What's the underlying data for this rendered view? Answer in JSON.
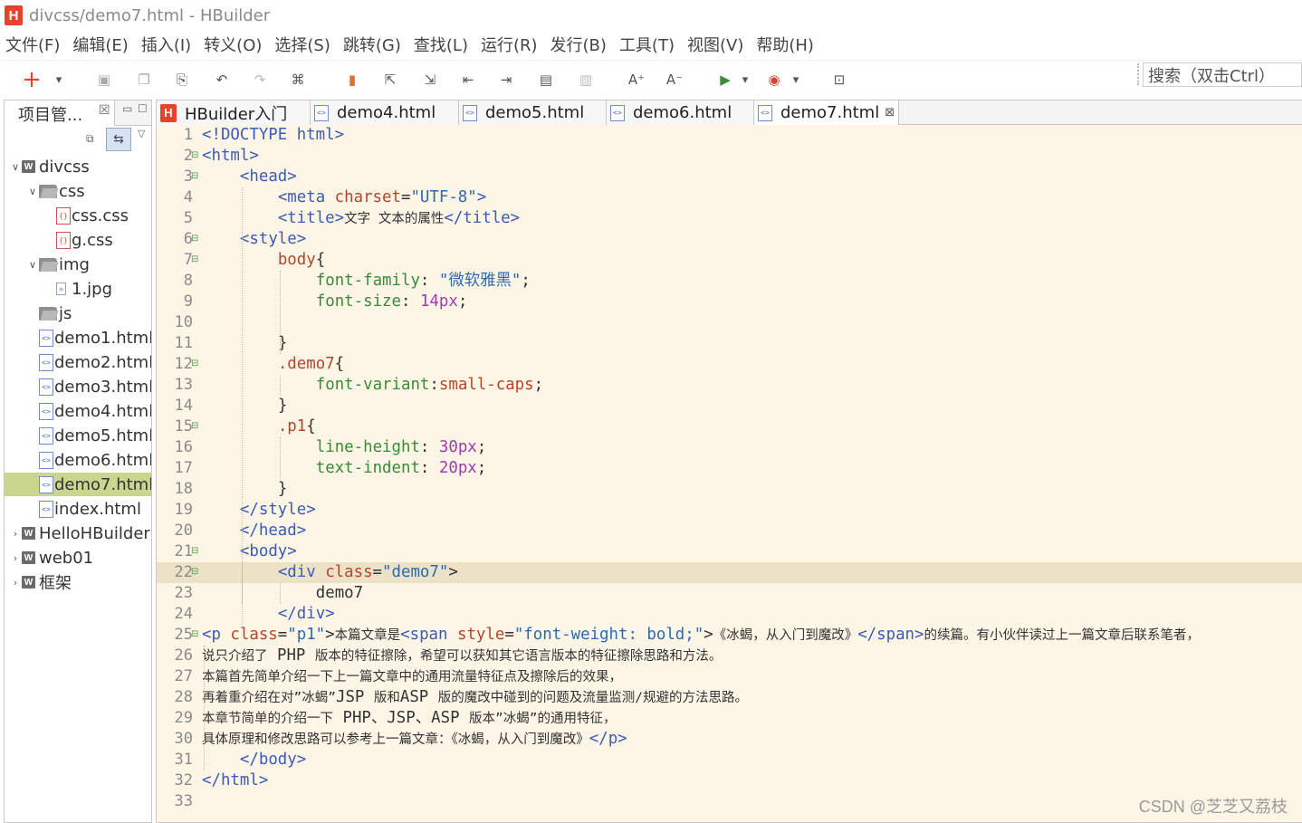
{
  "window": {
    "title": "divcss/demo7.html  -  HBuilder",
    "logo": "H"
  },
  "menu": [
    "文件(F)",
    "编辑(E)",
    "插入(I)",
    "转义(O)",
    "选择(S)",
    "跳转(G)",
    "查找(L)",
    "运行(R)",
    "发行(B)",
    "工具(T)",
    "视图(V)",
    "帮助(H)"
  ],
  "toolbar": {
    "search_placeholder": "搜索（双击Ctrl）",
    "icons": [
      "new-icon",
      "dropdown-icon",
      "save-icon",
      "save-all-icon",
      "copy-icon",
      "undo-icon",
      "redo-icon",
      "format-icon",
      "bookmark-icon",
      "goto-icon",
      "jump-icon",
      "move-left-icon",
      "move-right-icon",
      "comment-icon",
      "uncomment-icon",
      "font-increase-icon",
      "font-decrease-icon",
      "run-icon",
      "run-dropdown-icon",
      "browser-icon",
      "browser-dropdown-icon",
      "preview-icon"
    ]
  },
  "project_panel": {
    "tab_label": "项目管...",
    "tree": [
      {
        "label": "divcss",
        "level": 0,
        "kind": "project",
        "expanded": true
      },
      {
        "label": "css",
        "level": 1,
        "kind": "folder",
        "expanded": true
      },
      {
        "label": "css.css",
        "level": 2,
        "kind": "css"
      },
      {
        "label": "g.css",
        "level": 2,
        "kind": "css"
      },
      {
        "label": "img",
        "level": 1,
        "kind": "folder",
        "expanded": true
      },
      {
        "label": "1.jpg",
        "level": 2,
        "kind": "image"
      },
      {
        "label": "js",
        "level": 1,
        "kind": "folder"
      },
      {
        "label": "demo1.html",
        "level": 1,
        "kind": "html"
      },
      {
        "label": "demo2.html",
        "level": 1,
        "kind": "html"
      },
      {
        "label": "demo3.html",
        "level": 1,
        "kind": "html"
      },
      {
        "label": "demo4.html",
        "level": 1,
        "kind": "html"
      },
      {
        "label": "demo5.html",
        "level": 1,
        "kind": "html"
      },
      {
        "label": "demo6.html",
        "level": 1,
        "kind": "html"
      },
      {
        "label": "demo7.html",
        "level": 1,
        "kind": "html",
        "selected": true
      },
      {
        "label": "index.html",
        "level": 1,
        "kind": "html"
      },
      {
        "label": "HelloHBuilder",
        "level": 0,
        "kind": "project"
      },
      {
        "label": "web01",
        "level": 0,
        "kind": "project"
      },
      {
        "label": "框架",
        "level": 0,
        "kind": "project"
      }
    ]
  },
  "editor": {
    "tabs": [
      {
        "label": "HBuilder入门",
        "icon": "hbuilder-logo-icon"
      },
      {
        "label": "demo4.html",
        "icon": "html-file-icon"
      },
      {
        "label": "demo5.html",
        "icon": "html-file-icon"
      },
      {
        "label": "demo6.html",
        "icon": "html-file-icon"
      },
      {
        "label": "demo7.html",
        "icon": "html-file-icon",
        "active": true,
        "close": "⊠"
      }
    ],
    "current_line": 22,
    "lines": [
      {
        "n": "1",
        "segs": [
          [
            "<!DOCTYPE html>",
            "tag"
          ]
        ]
      },
      {
        "n": "2",
        "fold": true,
        "segs": [
          [
            "<html>",
            "tag"
          ]
        ]
      },
      {
        "n": "3",
        "fold": true,
        "indent": 4,
        "segs": [
          [
            "<head>",
            "tag"
          ]
        ]
      },
      {
        "n": "4",
        "indent": 8,
        "segs": [
          [
            "<meta ",
            "tag"
          ],
          [
            "charset",
            "att"
          ],
          [
            "=",
            ""
          ],
          [
            "\"UTF-8\"",
            "str"
          ],
          [
            ">",
            "tag"
          ]
        ]
      },
      {
        "n": "5",
        "indent": 8,
        "segs": [
          [
            "<title>",
            "tag"
          ],
          [
            "文字 文本的属性",
            "zh"
          ],
          [
            "</title>",
            "tag"
          ]
        ]
      },
      {
        "n": "6",
        "fold": true,
        "indent": 4,
        "segs": [
          [
            "<style>",
            "tag"
          ]
        ]
      },
      {
        "n": "7",
        "fold": true,
        "indent": 8,
        "segs": [
          [
            "body",
            "sel"
          ],
          [
            "{",
            ""
          ]
        ]
      },
      {
        "n": "8",
        "indent": 12,
        "segs": [
          [
            "font-family",
            "prop"
          ],
          [
            ": ",
            ""
          ],
          [
            "\"微软雅黑\"",
            "str"
          ],
          [
            ";",
            ""
          ]
        ]
      },
      {
        "n": "9",
        "indent": 12,
        "segs": [
          [
            "font-size",
            "prop"
          ],
          [
            ": ",
            ""
          ],
          [
            "14px",
            "num"
          ],
          [
            ";",
            ""
          ]
        ]
      },
      {
        "n": "10",
        "segs": []
      },
      {
        "n": "11",
        "indent": 8,
        "segs": [
          [
            "}",
            ""
          ]
        ]
      },
      {
        "n": "12",
        "fold": true,
        "indent": 8,
        "segs": [
          [
            ".demo7",
            "sel"
          ],
          [
            "{",
            ""
          ]
        ]
      },
      {
        "n": "13",
        "indent": 12,
        "segs": [
          [
            "font-variant",
            "prop"
          ],
          [
            ":",
            ""
          ],
          [
            "small-caps",
            "sel"
          ],
          [
            ";",
            ""
          ]
        ]
      },
      {
        "n": "14",
        "indent": 8,
        "segs": [
          [
            "}",
            ""
          ]
        ]
      },
      {
        "n": "15",
        "fold": true,
        "indent": 8,
        "segs": [
          [
            ".p1",
            "sel"
          ],
          [
            "{",
            ""
          ]
        ]
      },
      {
        "n": "16",
        "indent": 12,
        "segs": [
          [
            "line-height",
            "prop"
          ],
          [
            ": ",
            ""
          ],
          [
            "30px",
            "num"
          ],
          [
            ";",
            ""
          ]
        ]
      },
      {
        "n": "17",
        "indent": 12,
        "segs": [
          [
            "text-indent",
            "prop"
          ],
          [
            ": ",
            ""
          ],
          [
            "20px",
            "num"
          ],
          [
            ";",
            ""
          ]
        ]
      },
      {
        "n": "18",
        "indent": 8,
        "segs": [
          [
            "}",
            ""
          ]
        ]
      },
      {
        "n": "19",
        "indent": 4,
        "segs": [
          [
            "</style>",
            "tag"
          ]
        ]
      },
      {
        "n": "20",
        "indent": 4,
        "segs": [
          [
            "</head>",
            "tag"
          ]
        ]
      },
      {
        "n": "21",
        "fold": true,
        "indent": 4,
        "segs": [
          [
            "<body>",
            "tag"
          ]
        ]
      },
      {
        "n": "22",
        "fold": true,
        "indent": 8,
        "segs": [
          [
            "<div ",
            "tag"
          ],
          [
            "class",
            "att"
          ],
          [
            "=",
            ""
          ],
          [
            "\"demo7\"",
            "str"
          ],
          [
            ">",
            ""
          ]
        ]
      },
      {
        "n": "23",
        "indent": 12,
        "segs": [
          [
            "demo7",
            ""
          ]
        ]
      },
      {
        "n": "24",
        "indent": 8,
        "segs": [
          [
            "</div>",
            "tag"
          ]
        ]
      },
      {
        "n": "25",
        "fold": true,
        "segs": [
          [
            "<p ",
            "tag"
          ],
          [
            "class",
            "att"
          ],
          [
            "=",
            ""
          ],
          [
            "\"p1\"",
            "str"
          ],
          [
            ">",
            ""
          ],
          [
            "本篇文章是",
            "zh"
          ],
          [
            "<span ",
            "tag"
          ],
          [
            "style",
            "att"
          ],
          [
            "=",
            ""
          ],
          [
            "\"font-weight: bold;\"",
            "str"
          ],
          [
            ">",
            ""
          ],
          [
            "《冰蝎，从入门到魔改》",
            "zh"
          ],
          [
            "</span>",
            "tag"
          ],
          [
            "的续篇。有小伙伴读过上一篇文章后联系笔者，",
            "zh"
          ]
        ]
      },
      {
        "n": "26",
        "segs": [
          [
            "说只介绍了",
            "zh"
          ],
          [
            " PHP ",
            ""
          ],
          [
            "版本的特征擦除，希望可以获知其它语言版本的特征擦除思路和方法。",
            "zh"
          ]
        ]
      },
      {
        "n": "27",
        "segs": [
          [
            "本篇首先简单介绍一下上一篇文章中的通用流量特征点及擦除后的效果，",
            "zh"
          ]
        ]
      },
      {
        "n": "28",
        "segs": [
          [
            "再着重介绍在对”冰蝎”",
            "zh"
          ],
          [
            "JSP ",
            ""
          ],
          [
            "版和",
            "zh"
          ],
          [
            "ASP ",
            ""
          ],
          [
            "版的魔改中碰到的问题及流量监测/规避的方法思路。",
            "zh"
          ]
        ]
      },
      {
        "n": "29",
        "segs": [
          [
            "本章节简单的介绍一下",
            "zh"
          ],
          [
            " PHP",
            ""
          ],
          [
            "、",
            ""
          ],
          [
            "JSP",
            ""
          ],
          [
            "、",
            ""
          ],
          [
            "ASP ",
            ""
          ],
          [
            "版本”冰蝎”的通用特征，",
            "zh"
          ]
        ]
      },
      {
        "n": "30",
        "segs": [
          [
            "具体原理和修改思路可以参考上一篇文章：《冰蝎，从入门到魔改》",
            "zh"
          ],
          [
            "</p>",
            "tag"
          ]
        ]
      },
      {
        "n": "31",
        "indent": 4,
        "segs": [
          [
            "</body>",
            "tag"
          ]
        ]
      },
      {
        "n": "32",
        "segs": [
          [
            "</html>",
            "tag"
          ]
        ]
      },
      {
        "n": "33",
        "segs": []
      }
    ]
  },
  "watermark": "CSDN @芝芝又荔枝"
}
